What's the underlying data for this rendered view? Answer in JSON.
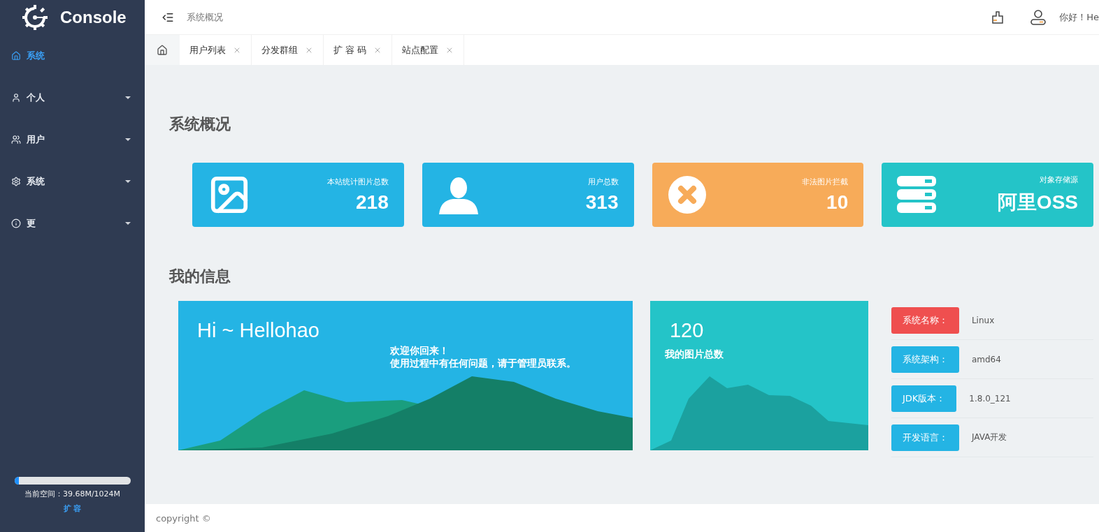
{
  "brand": "Console",
  "sidebar": {
    "items": [
      {
        "kind": "home",
        "label": "系统",
        "selected": true,
        "expandable": false
      },
      {
        "kind": "user",
        "label": "个人",
        "selected": false,
        "expandable": true
      },
      {
        "kind": "users",
        "label": "用户",
        "selected": false,
        "expandable": true
      },
      {
        "kind": "gear",
        "label": "系统",
        "selected": false,
        "expandable": true
      },
      {
        "kind": "info",
        "label": "更",
        "selected": false,
        "expandable": true
      }
    ],
    "storage": {
      "level": 0.04,
      "reading": "当前空间：39.68M/1024M",
      "action": "扩 容"
    }
  },
  "header": {
    "title": "系统概况",
    "greeting": "你好！He"
  },
  "tabs": [
    {
      "label": "用户列表"
    },
    {
      "label": "分发群组"
    },
    {
      "label": "扩 容 码"
    },
    {
      "label": "站点配置"
    }
  ],
  "overview": {
    "title": "系统概况",
    "cards": [
      {
        "kind": "image",
        "label": "本站统计图片总数",
        "value": "218",
        "color": "#24b4e4"
      },
      {
        "kind": "user",
        "label": "用户总数",
        "value": "313",
        "color": "#24b4e4"
      },
      {
        "kind": "blocked",
        "label": "非法图片拦截",
        "value": "10",
        "color": "#f7ab59"
      },
      {
        "kind": "storage",
        "label": "对象存储源",
        "value": "阿里OSS",
        "color": "#24c4c8"
      }
    ]
  },
  "my_info": {
    "title": "我的信息",
    "welcome": {
      "greeting": "Hi ~ Hellohao",
      "lines": [
        "欢迎你回来！",
        "使用过程中有任何问题，请于管理员联系。"
      ]
    },
    "images": {
      "count": "120",
      "label": "我的图片总数"
    },
    "details": [
      {
        "label": "系统名称：",
        "value": "Linux",
        "color": "#ef4f4f"
      },
      {
        "label": "系统架构：",
        "value": "amd64",
        "color": "#24b4e4"
      },
      {
        "label": "JDK版本：",
        "value": "1.8.0_121",
        "color": "#24b4e4"
      },
      {
        "label": "开发语言：",
        "value": "JAVA开发",
        "color": "#24b4e4"
      }
    ]
  },
  "footer": "copyright ©"
}
